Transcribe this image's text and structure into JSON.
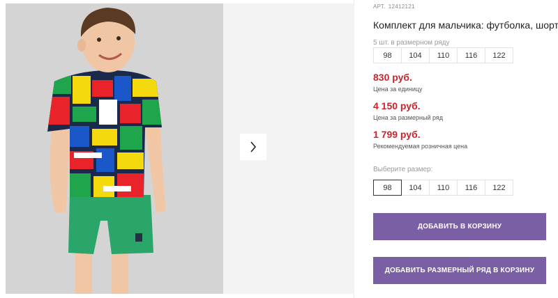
{
  "product": {
    "article_label": "АРТ.",
    "article_number": "12412121",
    "title": "Комплект для мальчика: футболка, шорты"
  },
  "series": {
    "label": "5 шт. в размерном ряду",
    "sizes": [
      "98",
      "104",
      "110",
      "116",
      "122"
    ]
  },
  "prices": [
    {
      "amount": "830 руб.",
      "note": "Цена за единицу"
    },
    {
      "amount": "4 150 руб.",
      "note": "Цена за размерный ряд"
    },
    {
      "amount": "1 799 руб.",
      "note": "Рекомендуемая розничная цена"
    }
  ],
  "size_picker": {
    "label": "Выберите размер:",
    "sizes": [
      "98",
      "104",
      "110",
      "116",
      "122"
    ],
    "selected": "98"
  },
  "buttons": {
    "add_to_cart": "ДОБАВИТЬ В КОРЗИНУ",
    "add_series_to_cart": "ДОБАВИТЬ РАЗМЕРНЫЙ РЯД В КОРЗИНУ"
  },
  "colors": {
    "price": "#d0202b",
    "button": "#7b5fa5",
    "tshirt_tiles": [
      "#1fa54b",
      "#f5d90f",
      "#e8232a",
      "#1a57c9",
      "#ffffff"
    ],
    "shorts": "#2aa66a"
  },
  "icons": {
    "gallery_next": "chevron-right-icon"
  }
}
